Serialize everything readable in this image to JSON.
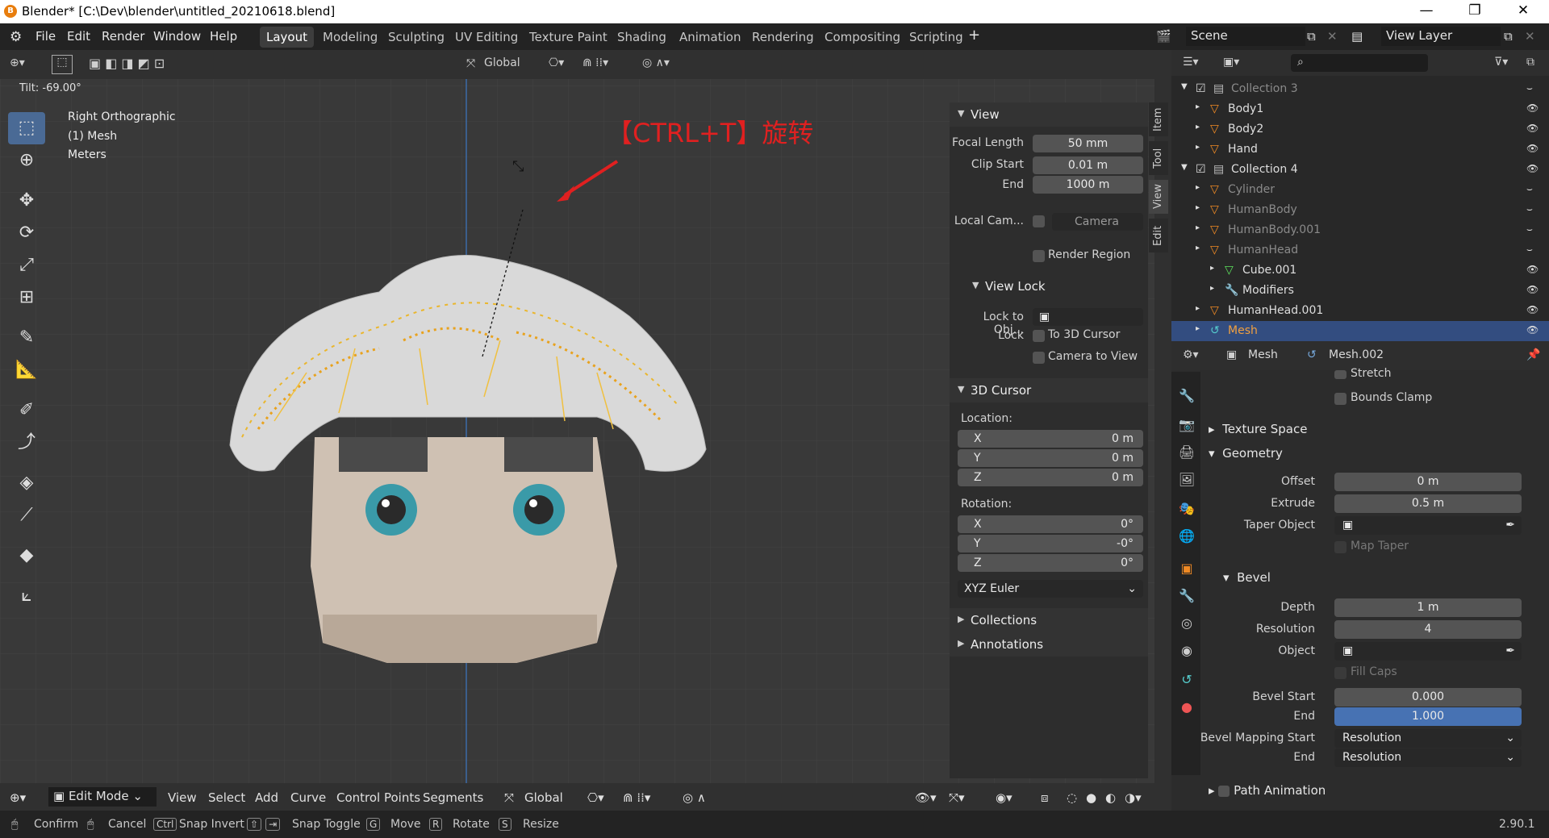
{
  "window": {
    "title": "Blender* [C:\\Dev\\blender\\untitled_20210618.blend]"
  },
  "menu": [
    "File",
    "Edit",
    "Render",
    "Window",
    "Help"
  ],
  "workspaces": [
    "Layout",
    "Modeling",
    "Sculpting",
    "UV Editing",
    "Texture Paint",
    "Shading",
    "Animation",
    "Rendering",
    "Compositing",
    "Scripting"
  ],
  "scene": {
    "name": "Scene",
    "view_layer": "View Layer"
  },
  "viewport": {
    "transform_orientation": "Global",
    "tilt": "Tilt: -69.00°",
    "overlay_lines": [
      "Right Orthographic",
      "(1) Mesh",
      "Meters"
    ],
    "annotation": "【CTRL+T】旋转",
    "mode": "Edit Mode",
    "bottom_menu": [
      "View",
      "Select",
      "Add",
      "Curve",
      "Control Points",
      "Segments"
    ],
    "bottom_orientation": "Global"
  },
  "npanel": {
    "tabs": [
      "Item",
      "Tool",
      "View",
      "Edit"
    ],
    "view": {
      "title": "View",
      "focal_length_label": "Focal Length",
      "focal_length": "50 mm",
      "clip_start_label": "Clip Start",
      "clip_start": "0.01 m",
      "end_label": "End",
      "clip_end": "1000 m",
      "local_cam_label": "Local Cam...",
      "camera": "Camera",
      "render_region": "Render Region"
    },
    "view_lock": {
      "title": "View Lock",
      "lock_to_obj_label": "Lock to Obj...",
      "lock_label": "Lock",
      "to_3d_cursor": "To 3D Cursor",
      "camera_to_view": "Camera to View"
    },
    "cursor": {
      "title": "3D Cursor",
      "location_label": "Location:",
      "rotation_label": "Rotation:",
      "loc": [
        {
          "axis": "X",
          "value": "0 m"
        },
        {
          "axis": "Y",
          "value": "0 m"
        },
        {
          "axis": "Z",
          "value": "0 m"
        }
      ],
      "rot": [
        {
          "axis": "X",
          "value": "0°"
        },
        {
          "axis": "Y",
          "value": "-0°"
        },
        {
          "axis": "Z",
          "value": "0°"
        }
      ],
      "rotation_mode": "XYZ Euler"
    },
    "collections": "Collections",
    "annotations": "Annotations"
  },
  "outliner": {
    "rows": [
      {
        "name": "Collection 3",
        "kind": "collection",
        "dim": true
      },
      {
        "name": "Body1",
        "kind": "object"
      },
      {
        "name": "Body2",
        "kind": "object"
      },
      {
        "name": "Hand",
        "kind": "object"
      },
      {
        "name": "Collection 4",
        "kind": "collection"
      },
      {
        "name": "Cylinder",
        "kind": "object",
        "dim": true
      },
      {
        "name": "HumanBody",
        "kind": "object",
        "dim": true
      },
      {
        "name": "HumanBody.001",
        "kind": "object",
        "dim": true
      },
      {
        "name": "HumanHead",
        "kind": "object",
        "dim": true
      },
      {
        "name": "Cube.001",
        "kind": "mesh"
      },
      {
        "name": "Modifiers",
        "kind": "mod"
      },
      {
        "name": "HumanHead.001",
        "kind": "object"
      },
      {
        "name": "Mesh",
        "kind": "curve",
        "selected": true
      }
    ]
  },
  "properties": {
    "object_name": "Mesh",
    "data_name": "Mesh.002",
    "stretch": "Stretch",
    "bounds_clamp": "Bounds Clamp",
    "texture_space": "Texture Space",
    "geometry": "Geometry",
    "offset_label": "Offset",
    "offset": "0 m",
    "extrude_label": "Extrude",
    "extrude": "0.5 m",
    "taper_label": "Taper Object",
    "map_taper": "Map Taper",
    "bevel": "Bevel",
    "depth_label": "Depth",
    "depth": "1 m",
    "resolution_label": "Resolution",
    "resolution": "4",
    "object_label": "Object",
    "fill_caps": "Fill Caps",
    "bevel_start_label": "Bevel Start",
    "bevel_start": "0.000",
    "end_label": "End",
    "bevel_end": "1.000",
    "mapping_start_label": "Bevel Mapping Start",
    "mapping_start": "Resolution",
    "mapping_end": "Resolution",
    "path_animation": "Path Animation"
  },
  "status": {
    "items": [
      "Confirm",
      "Cancel",
      "Snap Invert",
      "Snap Toggle",
      "Move",
      "Rotate",
      "Resize"
    ],
    "keys": [
      "Ctrl",
      "G",
      "R",
      "S"
    ],
    "version": "2.90.1"
  }
}
